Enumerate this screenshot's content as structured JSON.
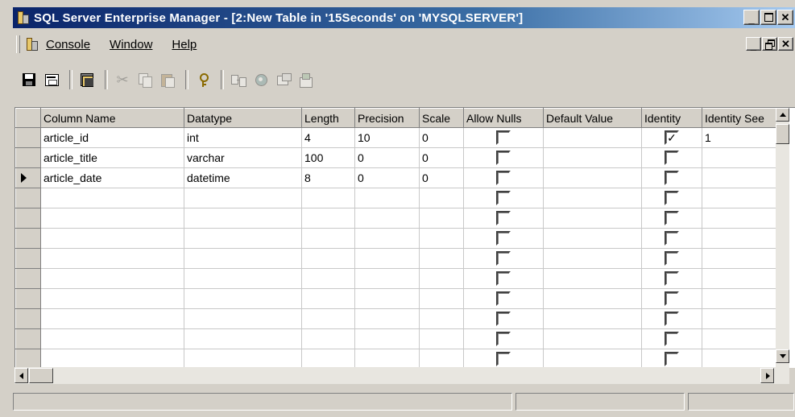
{
  "window": {
    "title": "SQL Server Enterprise Manager - [2:New Table in '15Seconds' on 'MYSQLSERVER']",
    "buttons": [
      "minimize-icon",
      "maximize-icon",
      "close-icon"
    ]
  },
  "menu": {
    "items": [
      {
        "label": "Console",
        "mnemonic": "C"
      },
      {
        "label": "Window",
        "mnemonic": "W"
      },
      {
        "label": "Help",
        "mnemonic": "H"
      }
    ]
  },
  "toolbar": {
    "icons": [
      "save-icon",
      "properties-icon",
      "table-icon",
      "cut-icon",
      "copy-icon",
      "paste-icon",
      "primary-key-icon",
      "manage-relationships-icon",
      "manage-indexes-icon",
      "manage-constraints-icon",
      "manage-triggers-icon"
    ]
  },
  "grid": {
    "columns": [
      "Column Name",
      "Datatype",
      "Length",
      "Precision",
      "Scale",
      "Allow Nulls",
      "Default Value",
      "Identity",
      "Identity See"
    ],
    "rows": [
      {
        "name": "article_id",
        "type": "int",
        "length": "4",
        "precision": "10",
        "scale": "0",
        "allow_nulls": false,
        "default": "",
        "identity": true,
        "identity_seed": "1",
        "current": false
      },
      {
        "name": "article_title",
        "type": "varchar",
        "length": "100",
        "precision": "0",
        "scale": "0",
        "allow_nulls": false,
        "default": "",
        "identity": false,
        "identity_seed": "",
        "current": false
      },
      {
        "name": "article_date",
        "type": "datetime",
        "length": "8",
        "precision": "0",
        "scale": "0",
        "allow_nulls": false,
        "default": "",
        "identity": false,
        "identity_seed": "",
        "current": true
      }
    ],
    "empty_rows": 9,
    "check_mark": "✓"
  },
  "colors": {
    "title_gradient_start": "#0a246a",
    "title_gradient_end": "#a6caf0",
    "face": "#d4d0c8"
  }
}
